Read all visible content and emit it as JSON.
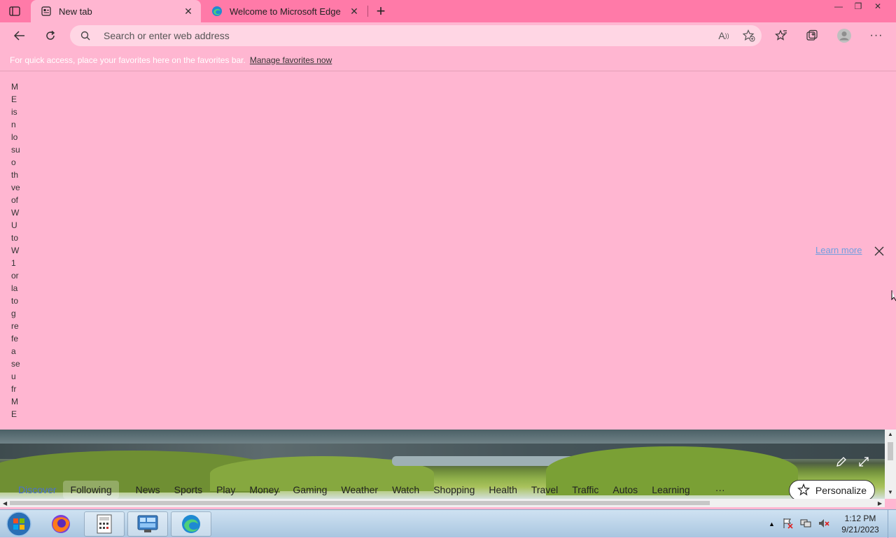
{
  "tabs": [
    {
      "label": "New tab",
      "active": true
    },
    {
      "label": "Welcome to Microsoft Edge",
      "active": false
    }
  ],
  "address": {
    "placeholder": "Search or enter web address"
  },
  "favorites_bar": {
    "hint": "For quick access, place your favorites here on the favorites bar.",
    "link": "Manage favorites now"
  },
  "banner": {
    "vertical_text": [
      "M",
      "E",
      "is",
      "n",
      "lo",
      "su",
      "o",
      "th",
      "ve",
      "of",
      "W",
      "U",
      "to",
      "W",
      "1",
      "or",
      "la",
      "to",
      "g",
      "re",
      "fe",
      "a",
      "se",
      "u",
      "fr",
      "M",
      "E"
    ],
    "learn_more": "Learn more"
  },
  "feed_nav": {
    "items": [
      "Discover",
      "Following",
      "News",
      "Sports",
      "Play",
      "Money",
      "Gaming",
      "Weather",
      "Watch",
      "Shopping",
      "Health",
      "Travel",
      "Traffic",
      "Autos",
      "Learning"
    ],
    "more": "···",
    "personalize": "Personalize"
  },
  "taskbar": {
    "time": "1:12 PM",
    "date": "9/21/2023"
  },
  "colors": {
    "titlebar": "#ff7aa8",
    "page": "#ffb6d1",
    "accent": "#4a6fd6"
  }
}
